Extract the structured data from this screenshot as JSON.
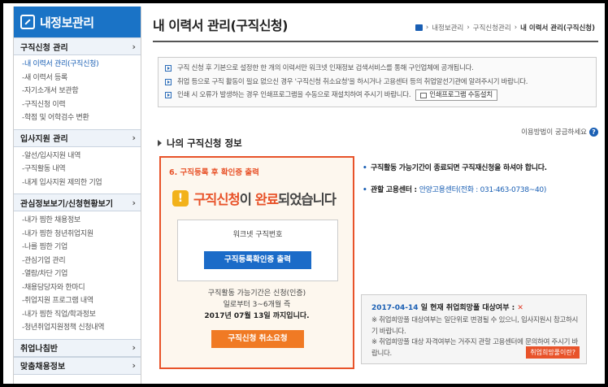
{
  "sidebar": {
    "title": "내정보관리",
    "sections": [
      {
        "label": "구직신청 관리",
        "items": [
          "-내 이력서 관리(구직신청)",
          "-새 이력서 등록",
          "-자기소개서 보관함",
          "-구직신청 이력",
          "-학점 및 어학검수 변환"
        ]
      },
      {
        "label": "입사지원 관리",
        "items": [
          "-알선/입사지원 내역",
          "-구직활동 내역",
          "-내게 입사지원 제의한 기업"
        ]
      },
      {
        "label": "관심정보보기/신청현황보기",
        "items": [
          "-내가 찜한 채용정보",
          "-내가 찜한 청년취업지원",
          "-나를 찜한 기업",
          "-관심기업 관리",
          "-열람/차단 기업",
          "-채용담당자와 한마디",
          "-취업지원 프로그램 내역",
          "-내가 찜한 직업/학과정보",
          "-청년취업지원정책 신청내역"
        ]
      },
      {
        "label": "취업나침반",
        "items": []
      },
      {
        "label": "맞춤채용정보",
        "items": []
      }
    ],
    "active_item": "-내 이력서 관리(구직신청)",
    "chevron": "›"
  },
  "page": {
    "title": "내 이력서 관리(구직신청)",
    "breadcrumb": [
      "내정보관리",
      "구직신청관리",
      "내 이력서 관리(구직신청)"
    ],
    "breadcrumb_sep": "›"
  },
  "notice": {
    "lines": [
      "구직 신청 후 기본으로 설정한 한 개의 이력서만 워크넷 인재정보 검색서비스를 통해 구인업체에 공개됩니다.",
      "취업 등으로 구직 활동이 필요 없으신 경우 '구직신청 취소요청'을 하시거나 고용센터 등의 취업알선기관에 알려주시기 바랍니다.",
      "인쇄 시 오류가 발생하는 경우 인쇄프로그램을 수동으로 재설치하여 주시기 바랍니다."
    ],
    "print_button": "인쇄프로그램 수동설치"
  },
  "help_link": "이용방법이 궁금하세요",
  "help_glyph": "?",
  "section_title": "나의 구직신청 정보",
  "result": {
    "step_label": "6. 구직등록 후 확인증 출력",
    "complete_a": "구직신청",
    "complete_b": "이 ",
    "complete_c": "완료",
    "complete_d": "되었습니다",
    "card_label": "워크넷 구직번호",
    "print_confirm_button": "구직등록확인증 출력",
    "period_line1": "구직활동 가능기간은 신청(인증)",
    "period_line2": "일로부터 3~6개월 즉",
    "period_line3": "2017년 07월 13일 까지입니다.",
    "cancel_button": "구직신청 취소요청",
    "warn_glyph": "!"
  },
  "info": {
    "line1": "구직활동 가능기간이 종료되면 구직재신청을 하셔야 합니다.",
    "center_label": "관할 고용센터 : ",
    "center_value": "안양고용센터(전화 : 031-463-0738~40)"
  },
  "status": {
    "date": "2017-04-14",
    "text": " 일 현재 취업희망풀 대상여부 : ",
    "mark": "✕",
    "note1": "※ 취업희망풀 대상여부는 일단위로 변경될 수 있으니, 입사지원시 참고하시기 바랍니다.",
    "note2": "※ 취업희망풀 대상 자격여부는 거주지 관할 고용센터에 문의하여 주시기 바랍니다.",
    "badge": "취업희망풀이란?"
  },
  "colors": {
    "brand": "#1a73c6",
    "accent": "#e8532a",
    "button_blue": "#1b6bc8",
    "button_orange": "#f07a24"
  }
}
